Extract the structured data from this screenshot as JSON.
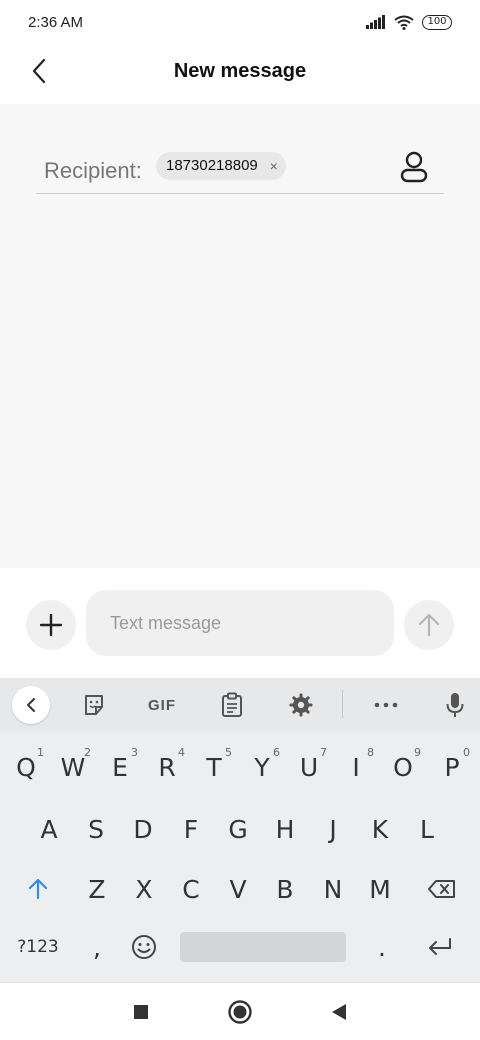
{
  "status_bar": {
    "time": "2:36 AM",
    "battery": "100",
    "icons": [
      "signal-icon",
      "wifi-icon",
      "battery-icon"
    ]
  },
  "header": {
    "title": "New message",
    "back_icon": "chevron-left-icon"
  },
  "recipient": {
    "label": "Recipient:",
    "chip_value": "18730218809",
    "chip_remove": "×",
    "contacts_icon": "person-icon"
  },
  "compose": {
    "placeholder": "Text message",
    "attach_icon": "plus-icon",
    "send_icon": "arrow-up-icon"
  },
  "keyboard": {
    "toolbar": {
      "gif_label": "GIF",
      "icons": [
        "chevron-left-icon",
        "sticker-icon",
        "gif-icon",
        "clipboard-icon",
        "gear-icon",
        "more-icon",
        "mic-icon"
      ]
    },
    "row1": [
      {
        "key": "Q",
        "hint": "1"
      },
      {
        "key": "W",
        "hint": "2"
      },
      {
        "key": "E",
        "hint": "3"
      },
      {
        "key": "R",
        "hint": "4"
      },
      {
        "key": "T",
        "hint": "5"
      },
      {
        "key": "Y",
        "hint": "6"
      },
      {
        "key": "U",
        "hint": "7"
      },
      {
        "key": "I",
        "hint": "8"
      },
      {
        "key": "O",
        "hint": "9"
      },
      {
        "key": "P",
        "hint": "0"
      }
    ],
    "row2": [
      "A",
      "S",
      "D",
      "F",
      "G",
      "H",
      "J",
      "K",
      "L"
    ],
    "row3": [
      "Z",
      "X",
      "C",
      "V",
      "B",
      "N",
      "M"
    ],
    "bottom": {
      "symbols": "?123",
      "comma": ",",
      "period": "."
    },
    "accent_color": "#2f8ee0"
  },
  "nav_bar": {
    "icons": [
      "recents-square-icon",
      "home-circle-icon",
      "back-triangle-icon"
    ]
  }
}
